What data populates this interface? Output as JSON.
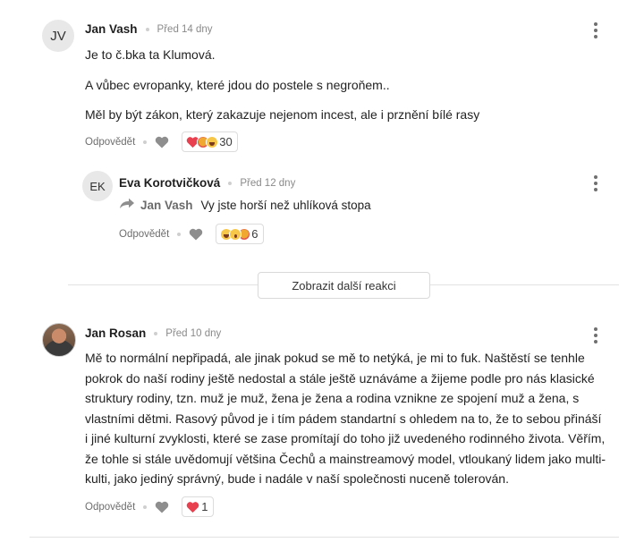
{
  "comments": [
    {
      "initials": "JV",
      "author": "Jan Vash",
      "time": "Před 14 dny",
      "paragraphs": [
        "Je to č.bka ta Klumová.",
        "A vůbec evropanky, které jdou do postele s negroňem..",
        "Měl by být zákon, který zakazuje nejenom incest, ale i prznění bílé rasy"
      ],
      "reply_label": "Odpovědět",
      "reaction_icons": [
        "heart-icon",
        "angry-icon",
        "laugh-icon"
      ],
      "reaction_count": "30"
    },
    {
      "initials": "EK",
      "author": "Eva Korotvičková",
      "time": "Před 12 dny",
      "reply_to": "Jan Vash",
      "text": "Vy jste horší než uhlíková stopa",
      "reply_label": "Odpovědět",
      "reaction_icons": [
        "laugh-icon",
        "wow-icon",
        "angry-icon"
      ],
      "reaction_count": "6"
    },
    {
      "author": "Jan Rosan",
      "time": "Před 10 dny",
      "lines": [
        "Mě to normální nepřipadá, ale jinak pokud se mě to netýká, je mi to fuk. Naštěstí se tenhle",
        "pokrok do naší rodiny ještě nedostal a stále ještě uznáváme a žijeme podle pro nás klasické",
        "struktury rodiny, tzn. muž je muž, žena je žena a rodina vznikne ze spojení muž a žena, s",
        "vlastními dětmi. Rasový původ je i tím pádem standartní s ohledem na to, že to sebou přináší",
        "i jiné kulturní zvyklosti, které se zase promítají do toho již uvedeného rodinného života. Věřím,",
        "že tohle si stále uvědomují většina Čechů a mainstreamový model, vtloukaný lidem jako multi-",
        "kulti, jako jediný správný, bude i nadále v naší společnosti nuceně tolerován."
      ],
      "reply_label": "Odpovědět",
      "reaction_icons": [
        "heart-icon"
      ],
      "reaction_count": "1"
    }
  ],
  "more_reactions_label": "Zobrazit další reakci",
  "colors": {
    "heart": "#e8404f",
    "outline_heart": "#8e8e8e",
    "text": "#222222",
    "muted": "#8a8a8a"
  }
}
